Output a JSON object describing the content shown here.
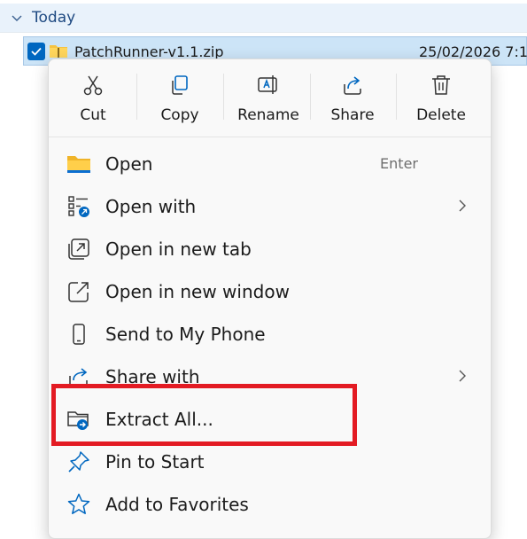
{
  "group": {
    "label": "Today",
    "chevron_icon": "chevron-down-icon"
  },
  "file": {
    "name": "PatchRunner-v1.1.zip",
    "date": "25/02/2026 7:1",
    "checked": true,
    "icon": "zip-folder-icon"
  },
  "context_menu": {
    "actions": [
      {
        "label": "Cut",
        "icon": "scissors-icon"
      },
      {
        "label": "Copy",
        "icon": "copy-icon"
      },
      {
        "label": "Rename",
        "icon": "rename-icon"
      },
      {
        "label": "Share",
        "icon": "share-icon"
      },
      {
        "label": "Delete",
        "icon": "trash-icon"
      }
    ],
    "items": [
      {
        "label": "Open",
        "shortcut": "Enter",
        "icon": "folder-icon"
      },
      {
        "label": "Open with",
        "icon": "open-with-icon",
        "submenu": true
      },
      {
        "label": "Open in new tab",
        "icon": "new-tab-icon"
      },
      {
        "label": "Open in new window",
        "icon": "new-window-icon"
      },
      {
        "label": "Send to My Phone",
        "icon": "phone-icon"
      },
      {
        "label": "Share with",
        "icon": "share-with-icon",
        "submenu": true
      },
      {
        "label": "Extract All...",
        "icon": "extract-icon",
        "highlighted": true
      },
      {
        "label": "Pin to Start",
        "icon": "pin-icon"
      },
      {
        "label": "Add to Favorites",
        "icon": "star-icon"
      }
    ]
  },
  "colors": {
    "accent": "#0067c0",
    "highlight_border": "#e31b23",
    "selection_bg": "#cce4f7",
    "group_header_bg": "#e9f2fb"
  }
}
